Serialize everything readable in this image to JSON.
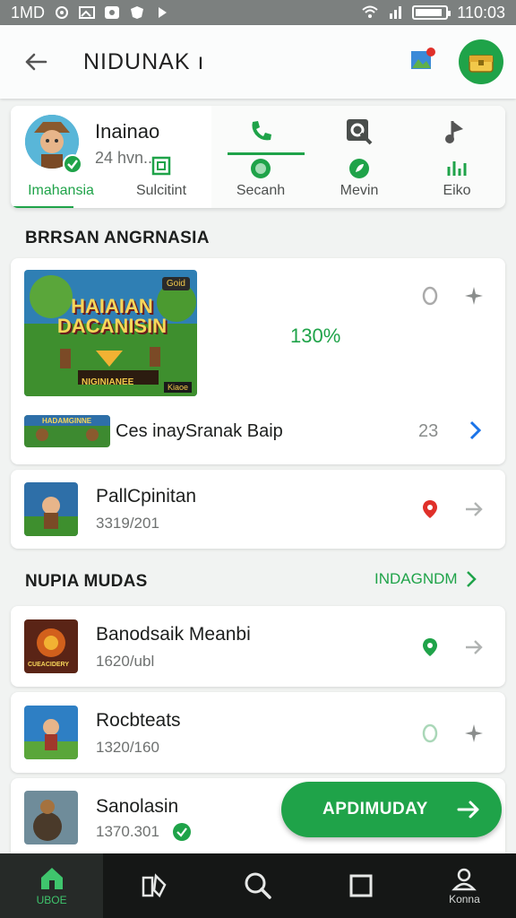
{
  "status_bar": {
    "time_left": "1MD",
    "time_right": "110:03",
    "battery_level": 0.9
  },
  "app_bar": {
    "title": "NIDUNAK ı",
    "back_icon": "arrow-left-icon",
    "photo_icon": "photo-notification-icon",
    "badge_icon": "game-badge-icon"
  },
  "profile": {
    "name": "Inainao",
    "subtitle": "24 hvn..",
    "tabs": [
      {
        "label": "Imahansia",
        "icon": "home-icon"
      },
      {
        "label": "Sulcitint",
        "icon": "grid-icon"
      },
      {
        "label": "Secanh",
        "icon": "phone-icon"
      },
      {
        "label": "Mevin",
        "icon": "search-icon"
      },
      {
        "label": "Eiko",
        "icon": "music-icon"
      }
    ]
  },
  "section1": {
    "title": "BRRSAN ANGRNASIA"
  },
  "featured": {
    "banner_title": "HAIAIAN DACANISIN",
    "banner_tag": "Goid",
    "banner_caption": "NIGINIANEE",
    "banner_badge": "Kiaoe",
    "progress": "130%",
    "count_icon": "zero-icon",
    "star_icon": "sparkle-icon",
    "secondary_title": "Ces inaySranak Baip",
    "secondary_count": "23",
    "secondary_thumb_text": "HADAMGINNE"
  },
  "row_pall": {
    "title": "PallCpinitan",
    "subtitle": "3319/201"
  },
  "section2": {
    "title": "NUPIA MUDAS",
    "link": "INDAGNDM"
  },
  "list": [
    {
      "title": "Banodsaik Meanbi",
      "subtitle": "1620/ubl",
      "thumb_text": "CUEACIDERY"
    },
    {
      "title": "Rocbteats",
      "subtitle": "1320/160"
    },
    {
      "title": "Sanolasin",
      "subtitle": "1370.301"
    }
  ],
  "fab": {
    "label": "APDIMUDAY"
  },
  "bottom_nav": [
    {
      "label": "UBOE",
      "icon": "home-icon"
    },
    {
      "label": "",
      "icon": "tools-icon"
    },
    {
      "label": "",
      "icon": "search-icon"
    },
    {
      "label": "",
      "icon": "square-icon"
    },
    {
      "label": "Konna",
      "icon": "profile-icon"
    }
  ],
  "colors": {
    "accent": "#1fa349",
    "link_blue": "#1a73e8",
    "marker_red": "#e0302a"
  }
}
